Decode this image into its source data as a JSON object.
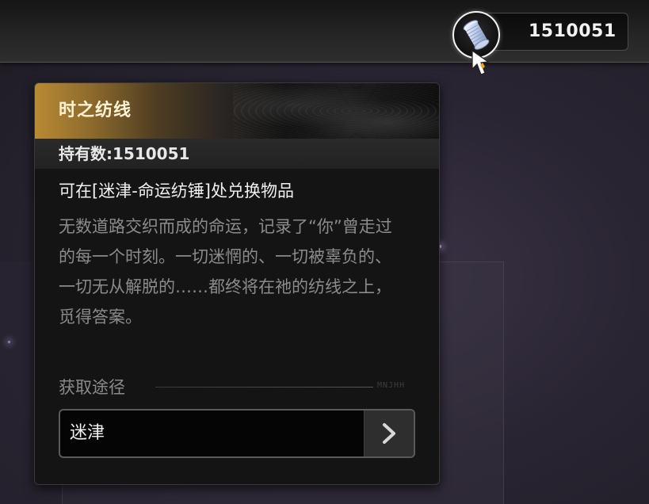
{
  "currency": {
    "value": "1510051",
    "icon": "spool-icon"
  },
  "tooltip": {
    "title": "时之纺线",
    "held": "持有数:1510051",
    "exchange": "可在[迷津-命运纺锤]处兑换物品",
    "description": "无数道路交织而成的命运，记录了“你”曾走过的每一个时刻。一切迷惘的、一切被辜负的、一切无从解脱的……都终将在祂的纺线之上，觅得答案。",
    "source_label": "获取途径",
    "source_deco": "MNJHH",
    "sources": [
      {
        "label": "迷津",
        "icon": "chevron-right-icon"
      }
    ]
  },
  "colors": {
    "title_gold": "#b98a34",
    "title_text": "#fff3d6",
    "panel_bg": "#141414",
    "muted_text": "#8b8b8b"
  }
}
